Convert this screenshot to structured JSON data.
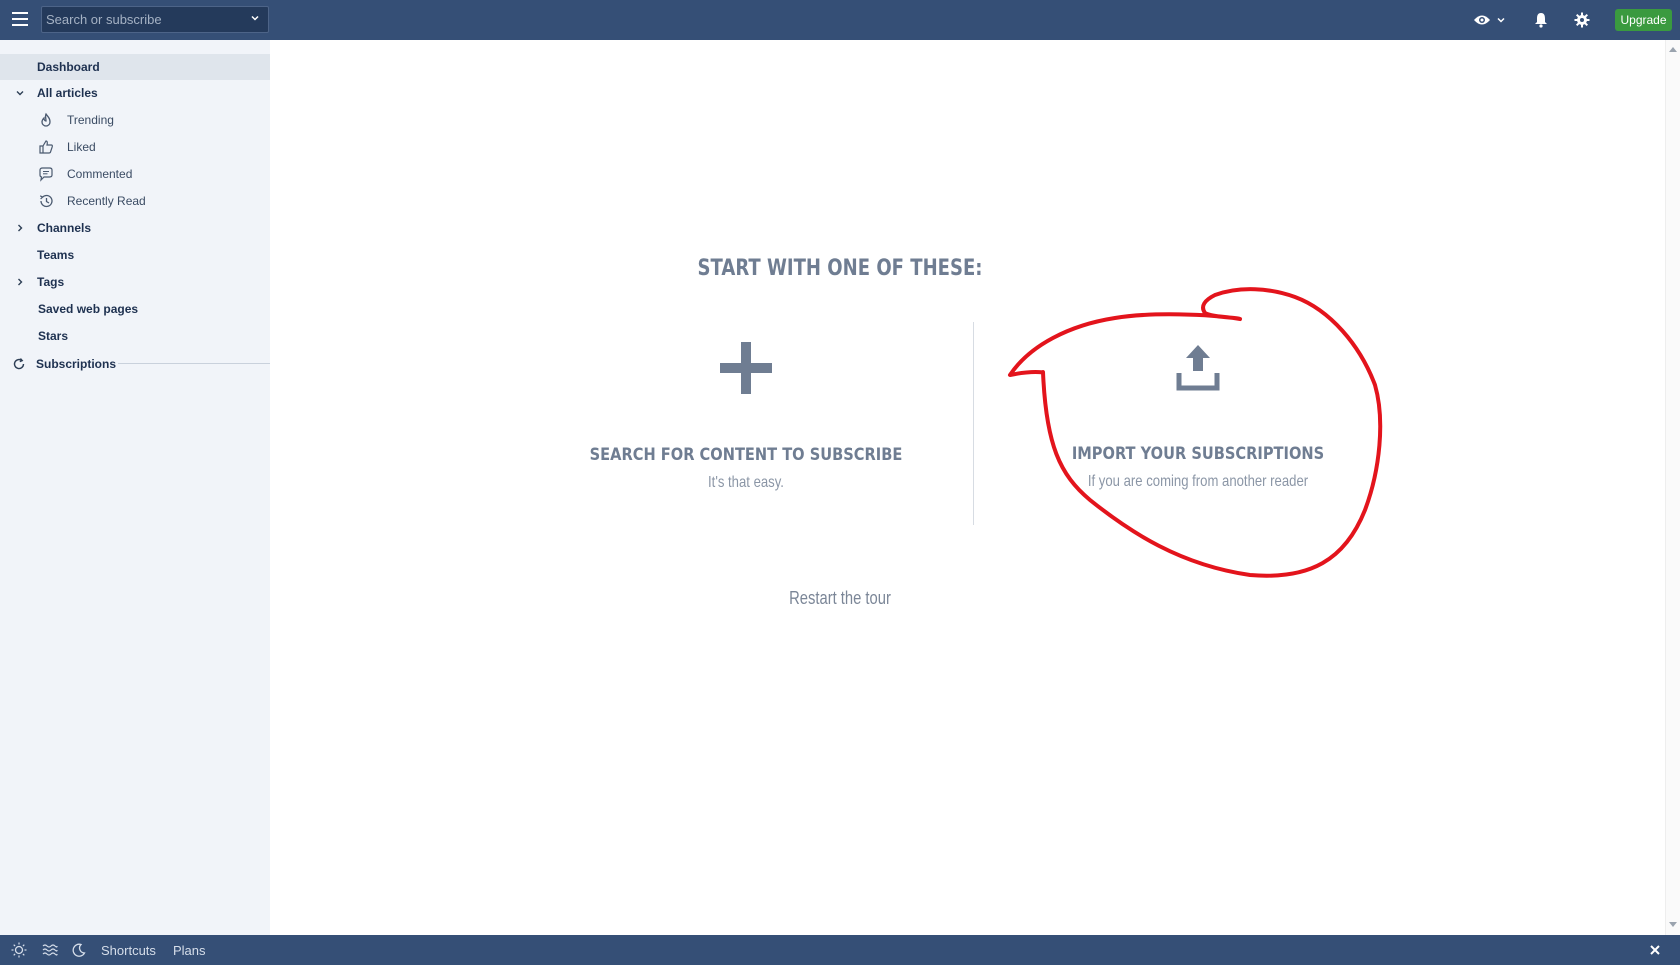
{
  "topbar": {
    "menu_icon": "hamburger-icon",
    "search_placeholder": "Search or subscribe",
    "upgrade_label": "Upgrade",
    "icons": [
      "eye-icon",
      "chevron-down-icon",
      "bell-icon",
      "gear-icon"
    ]
  },
  "sidebar": {
    "dashboard": "Dashboard",
    "all_articles": "All articles",
    "trending": "Trending",
    "liked": "Liked",
    "commented": "Commented",
    "recently_read": "Recently Read",
    "channels": "Channels",
    "teams": "Teams",
    "tags": "Tags",
    "saved_web_pages": "Saved web pages",
    "stars": "Stars",
    "subscriptions": "Subscriptions"
  },
  "main": {
    "heading": "START WITH ONE OF THESE:",
    "option_search": {
      "title": "SEARCH FOR CONTENT TO SUBSCRIBE",
      "subtitle": "It's that easy."
    },
    "option_import": {
      "title": "IMPORT YOUR SUBSCRIPTIONS",
      "subtitle": "If you are coming from another reader"
    },
    "restart": "Restart the tour"
  },
  "bottombar": {
    "shortcuts": "Shortcuts",
    "plans": "Plans"
  },
  "colors": {
    "topbar": "#354f76",
    "sidebar_bg": "#f1f4f9",
    "accent_green": "#3a9a3f",
    "annotation_red": "#e3141c",
    "muted_text": "#6f7d92"
  }
}
